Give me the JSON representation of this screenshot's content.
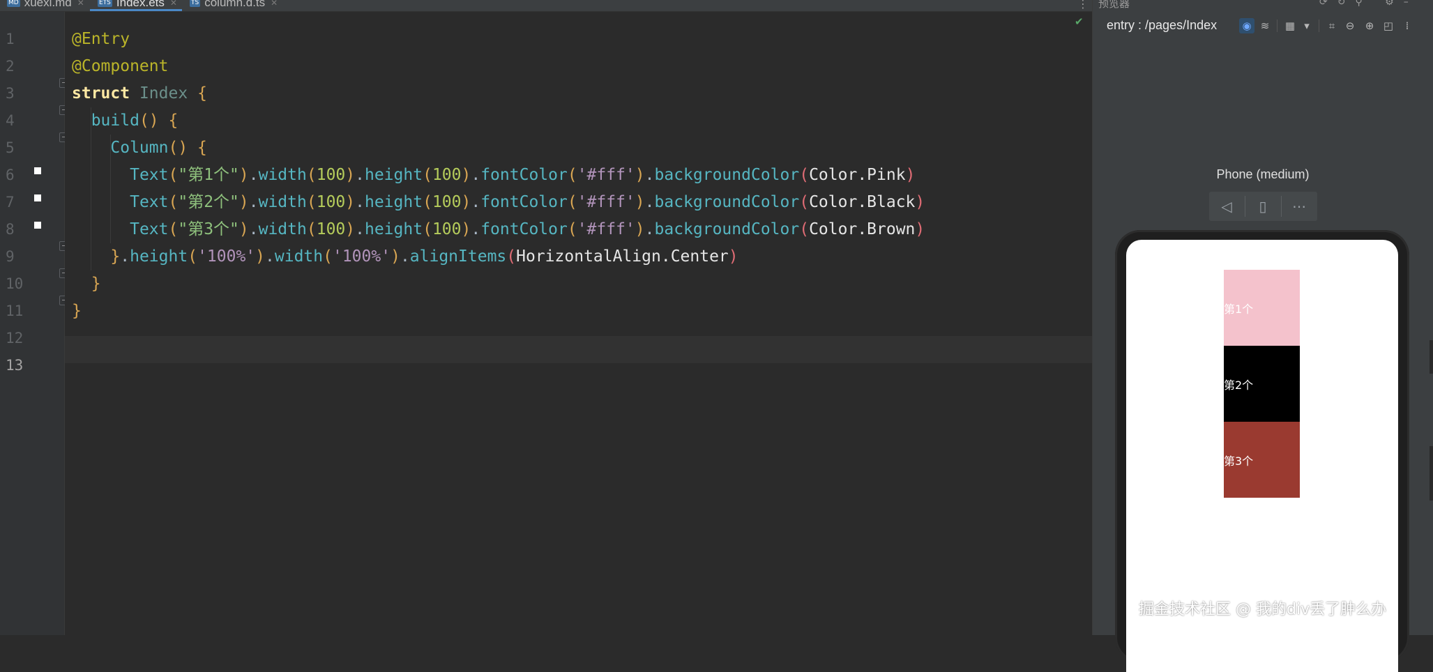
{
  "tabs": [
    {
      "type": "MD",
      "name": "xuexi.md"
    },
    {
      "type": "ETS",
      "name": "Index.ets",
      "active": true
    },
    {
      "type": "TS",
      "name": "column.d.ts"
    }
  ],
  "editor": {
    "line_numbers": [
      "1",
      "2",
      "3",
      "4",
      "5",
      "6",
      "7",
      "8",
      "9",
      "10",
      "11",
      "12",
      "13"
    ],
    "current_line": "13",
    "code": {
      "l1": "@Entry",
      "l2": "@Component",
      "l3_kw": "struct",
      "l3_name": "Index",
      "l4_fn": "build",
      "l5_fn": "Column",
      "text_fn": "Text",
      "rows": [
        {
          "label": "\"第1个\"",
          "color": "Color.Pink"
        },
        {
          "label": "\"第2个\"",
          "color": "Color.Black"
        },
        {
          "label": "\"第3个\"",
          "color": "Color.Brown"
        }
      ],
      "width_fn": "width",
      "height_fn": "height",
      "fontcolor_fn": "fontColor",
      "bg_fn": "backgroundColor",
      "num100": "100",
      "fff": "'#fff'",
      "l9_height_arg": "'100%'",
      "l9_width_arg": "'100%'",
      "l9_align_fn": "alignItems",
      "l9_align_arg": "HorizontalAlign.Center"
    }
  },
  "previewer": {
    "panel_title": "预览器",
    "route": "entry : /pages/Index",
    "device": "Phone (medium)",
    "boxes": [
      {
        "label": "第1个",
        "color": "#f4c2cc"
      },
      {
        "label": "第2个",
        "color": "#000000"
      },
      {
        "label": "第3个",
        "color": "#9a3a30"
      }
    ]
  },
  "watermark": "掘金技术社区 @ 我的div丢了肿么办",
  "colors": {
    "accent": "#4a88c7",
    "success": "#59a869"
  }
}
